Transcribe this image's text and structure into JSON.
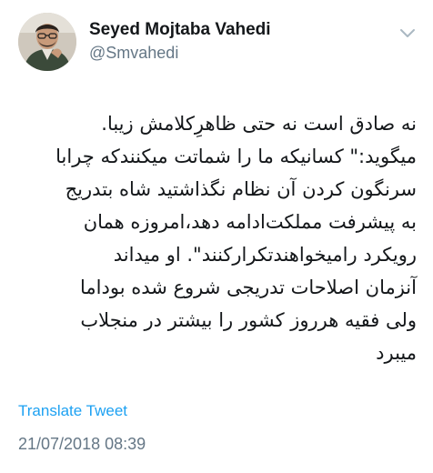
{
  "author": {
    "display_name": "Seyed Mojtaba Vahedi",
    "handle": "@Smvahedi",
    "avatar_icon": "profile-photo"
  },
  "tweet": {
    "lines": [
      "نه صادق است نه حتی ظاهرِکلامش زیبا.",
      "میگوید:\" کسانیکه ما را شماتت میکنندکه چرابا",
      "سرنگون کردن آن نظام نگذاشتید شاه بتدریج",
      "به پیشرفت مملکت‌ادامه دهد،امروزه همان",
      "رویکرد رامیخواهندتکرارکنند\". او میداند",
      "آنزمان اصلاحات تدریجی شروع شده بوداما",
      "ولی فقیه هرروز کشور را بیشتر در منجلاب",
      "میبرد"
    ]
  },
  "actions": {
    "translate_label": "Translate Tweet",
    "menu_icon": "chevron-down-icon"
  },
  "meta": {
    "timestamp": "21/07/2018 08:39"
  },
  "colors": {
    "link": "#1da1f2",
    "secondary_text": "#657786",
    "primary_text": "#14171a"
  }
}
